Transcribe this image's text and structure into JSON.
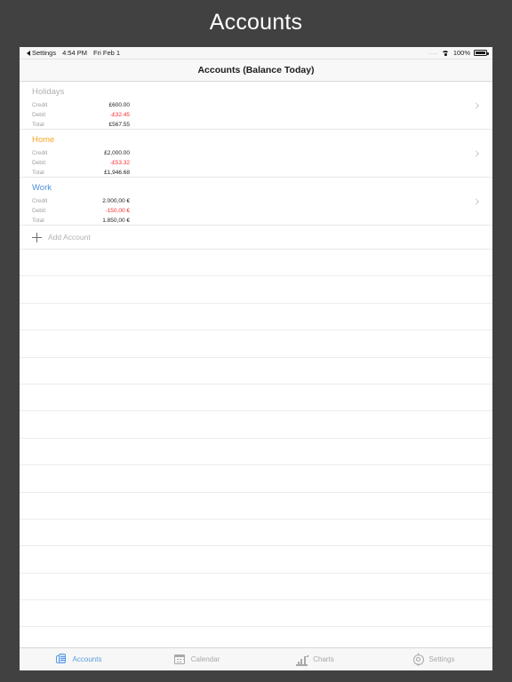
{
  "page": {
    "title": "Accounts"
  },
  "status_bar": {
    "back_label": "Settings",
    "time": "4:54 PM",
    "date": "Fri Feb 1",
    "signal_dots": "....",
    "wifi_icon": "wifi-icon",
    "battery_percent": "100%",
    "battery_icon": "battery-full-icon"
  },
  "nav_bar": {
    "title": "Accounts (Balance Today)"
  },
  "colors": {
    "page_background": "#414141",
    "account_holidays": "#b0b0b0",
    "account_home": "#f5a623",
    "account_work": "#4a90d9",
    "debit_red": "#fb2b2b",
    "tab_active": "#5b9ae3",
    "tab_inactive": "#a8a8a8"
  },
  "accounts": [
    {
      "name": "Holidays",
      "color": "#b0b0b0",
      "rows": [
        {
          "label": "Credit",
          "value": "£600.00"
        },
        {
          "label": "Debit",
          "value": "-£32.45"
        },
        {
          "label": "Total",
          "value": "£567.55"
        }
      ],
      "disclosure_icon": "chevron-right-icon"
    },
    {
      "name": "Home",
      "color": "#f5a623",
      "rows": [
        {
          "label": "Credit",
          "value": "£2,000.00"
        },
        {
          "label": "Debit",
          "value": "-£53.32"
        },
        {
          "label": "Total",
          "value": "£1,946.68"
        }
      ],
      "disclosure_icon": "chevron-right-icon"
    },
    {
      "name": "Work",
      "color": "#4a90d9",
      "rows": [
        {
          "label": "Credit",
          "value": "2.000,00 €"
        },
        {
          "label": "Debit",
          "value": "-150,00 €"
        },
        {
          "label": "Total",
          "value": "1.850,00 €"
        }
      ],
      "disclosure_icon": "chevron-right-icon"
    }
  ],
  "add_account": {
    "label": "Add Account",
    "icon": "plus-icon"
  },
  "empty_row_count": 15,
  "tab_bar": {
    "items": [
      {
        "label": "Accounts",
        "icon": "coins-icon",
        "active": true
      },
      {
        "label": "Calendar",
        "icon": "calendar-icon",
        "active": false
      },
      {
        "label": "Charts",
        "icon": "bar-chart-icon",
        "active": false
      },
      {
        "label": "Settings",
        "icon": "gear-icon",
        "active": false
      }
    ]
  }
}
